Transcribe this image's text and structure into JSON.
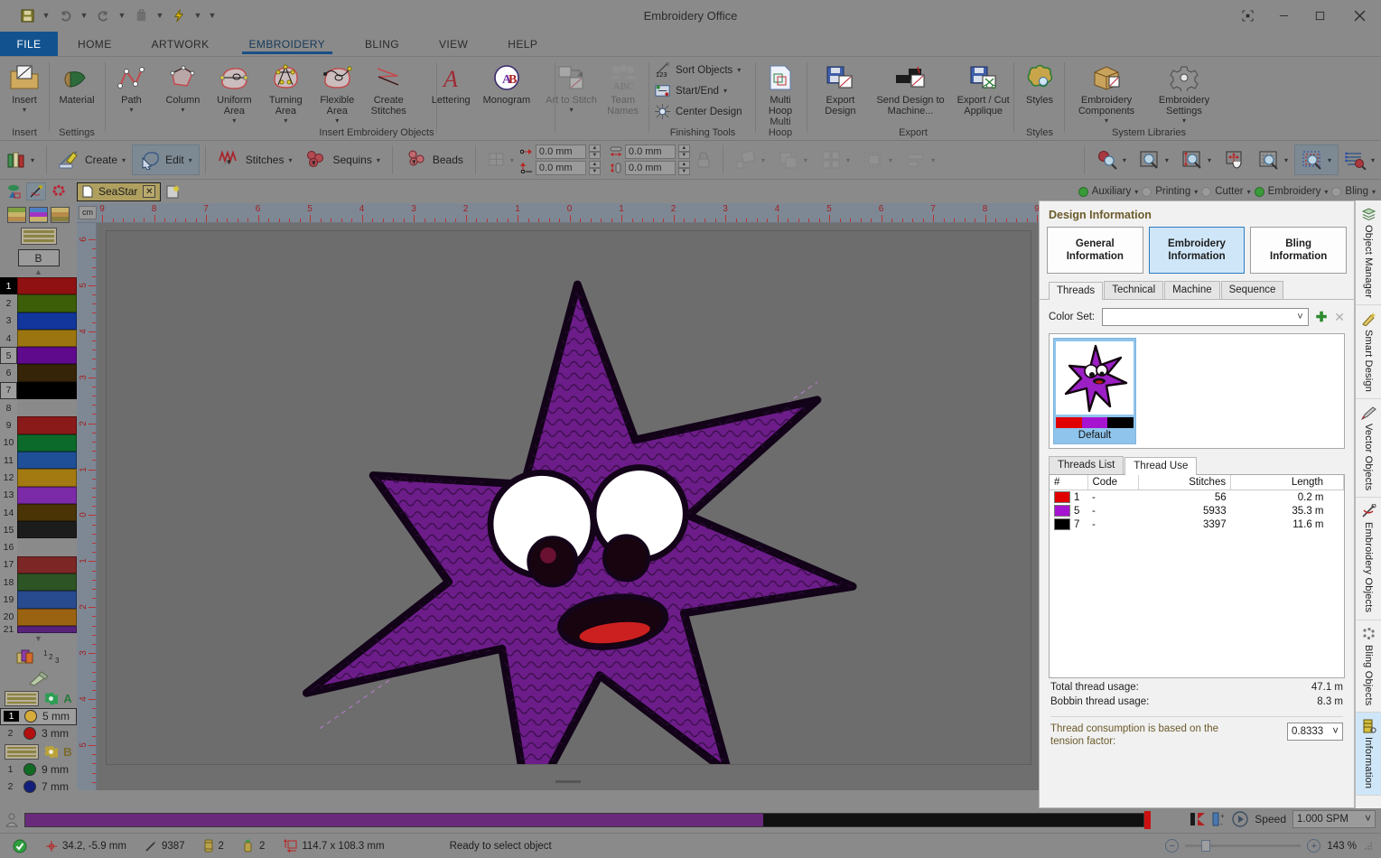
{
  "window": {
    "title": "Embroidery Office",
    "controls": [
      "restore-icon",
      "minimize-icon",
      "maximize-icon",
      "close-icon"
    ]
  },
  "quick_access": {
    "items": [
      {
        "name": "save-icon",
        "enabled": true
      },
      {
        "name": "undo-icon",
        "enabled": false
      },
      {
        "name": "redo-icon",
        "enabled": false
      },
      {
        "name": "clipboard-icon",
        "enabled": false
      },
      {
        "name": "lightning-icon",
        "enabled": true
      }
    ]
  },
  "ribbon": {
    "tabs": [
      {
        "label": "FILE",
        "active": false,
        "file": true
      },
      {
        "label": "HOME",
        "active": false
      },
      {
        "label": "ARTWORK",
        "active": false
      },
      {
        "label": "EMBROIDERY",
        "active": true
      },
      {
        "label": "BLING",
        "active": false
      },
      {
        "label": "VIEW",
        "active": false
      },
      {
        "label": "HELP",
        "active": false
      }
    ],
    "groups": [
      {
        "label": "Insert",
        "items": [
          {
            "label": "Insert",
            "caret": true,
            "disabled": false
          }
        ]
      },
      {
        "label": "Settings",
        "items": [
          {
            "label": "Material",
            "caret": false,
            "disabled": false
          }
        ]
      },
      {
        "label": "Insert Embroidery Objects",
        "items": [
          {
            "label": "Path",
            "caret": true,
            "disabled": false
          },
          {
            "label": "Column",
            "caret": true,
            "disabled": false
          },
          {
            "label": "Uniform Area",
            "caret": true,
            "disabled": false
          },
          {
            "label": "Turning Area",
            "caret": true,
            "disabled": false
          },
          {
            "label": "Flexible Area",
            "caret": true,
            "disabled": false
          },
          {
            "label": "Create Stitches",
            "caret": false,
            "disabled": false
          },
          {
            "label": "Lettering",
            "caret": false,
            "disabled": false
          },
          {
            "label": "Monogram",
            "caret": false,
            "disabled": false
          },
          {
            "label": "Art to Stitch",
            "caret": true,
            "disabled": true
          },
          {
            "label": "Team Names",
            "caret": false,
            "disabled": true
          }
        ]
      },
      {
        "label": "Finishing Tools",
        "items": [
          {
            "label": "Sort Objects",
            "caret": true,
            "disabled": false
          },
          {
            "label": "Start/End",
            "caret": true,
            "disabled": false
          },
          {
            "label": "Center Design",
            "caret": false,
            "disabled": false
          }
        ]
      },
      {
        "label": "Multi Hoop",
        "items": [
          {
            "label": "Multi Hoop",
            "caret": false,
            "disabled": false
          }
        ]
      },
      {
        "label": "Export",
        "items": [
          {
            "label": "Export Design",
            "caret": false,
            "disabled": false
          },
          {
            "label": "Send Design to Machine...",
            "caret": false,
            "disabled": false
          },
          {
            "label": "Export / Cut Applique",
            "caret": false,
            "disabled": false
          }
        ]
      },
      {
        "label": "Styles",
        "items": [
          {
            "label": "Styles",
            "caret": false,
            "disabled": false
          }
        ]
      },
      {
        "label": "System Libraries",
        "items": [
          {
            "label": "Embroidery Components",
            "caret": true,
            "disabled": false
          },
          {
            "label": "Embroidery Settings",
            "caret": true,
            "disabled": false
          }
        ]
      }
    ]
  },
  "toolbar": {
    "library_icon": "library-icon",
    "buttons": [
      {
        "label": "Create",
        "icon": "create-pencil-icon",
        "caret": true,
        "selected": false
      },
      {
        "label": "Edit",
        "icon": "edit-node-icon",
        "caret": true,
        "selected": true
      },
      {
        "label": "Stitches",
        "icon": "stitches-icon",
        "caret": true,
        "selected": false
      },
      {
        "label": "Sequins",
        "icon": "sequins-icon",
        "caret": true,
        "selected": false
      },
      {
        "label": "Beads",
        "icon": "beads-icon",
        "caret": false,
        "selected": false
      }
    ],
    "transform": {
      "x_value": "0.0 mm",
      "y_value": "0.0 mm",
      "width_value": "0.0 mm",
      "height_value": "0.0 mm",
      "lock_icon": "lock-icon"
    },
    "align_tools": [
      "rotate-icon",
      "group-icon",
      "arrange-grid-icon",
      "order-icon",
      "distribute-icon"
    ],
    "zoom_tools": [
      {
        "icon": "zoom-tool-icon",
        "caret": true,
        "selected": false
      },
      {
        "icon": "zoom-box-icon",
        "caret": true,
        "selected": false
      },
      {
        "icon": "zoom-height-icon",
        "caret": true,
        "selected": false
      },
      {
        "icon": "pan-icon",
        "caret": false,
        "selected": false
      },
      {
        "icon": "zoom-grid-icon",
        "caret": true,
        "selected": false
      },
      {
        "icon": "zoom-selection-icon",
        "caret": true,
        "selected": true
      },
      {
        "icon": "zoom-list-icon",
        "caret": true,
        "selected": false
      }
    ]
  },
  "document": {
    "tab_label": "SeaStar",
    "close_label": "✕",
    "left_icons": [
      "artwork-icon",
      "embroidery-icon",
      "bling-icon"
    ],
    "new_tab_icon": "new-document-icon"
  },
  "status_lights": [
    {
      "label": "Auxiliary",
      "on": true
    },
    {
      "label": "Printing",
      "on": false
    },
    {
      "label": "Cutter",
      "on": false
    },
    {
      "label": "Embroidery",
      "on": true
    },
    {
      "label": "Bling",
      "on": false
    }
  ],
  "left_palette": {
    "mode_swatches": [
      {
        "name": "swatch-set-a",
        "colors": [
          "#7fa040",
          "#c9b36a",
          "#b78b4a"
        ]
      },
      {
        "name": "swatch-set-b",
        "colors": [
          "#4d7fc4",
          "#a234c4",
          "#c9b36a"
        ]
      },
      {
        "name": "swatch-set-c",
        "colors": [
          "#c9b36a",
          "#b78b4a",
          "#8a7f3c"
        ]
      }
    ],
    "b_button": "B",
    "colors": [
      {
        "index": "1",
        "hex": "#8f1111",
        "state": "active"
      },
      {
        "index": "2",
        "hex": "#3d5e08",
        "state": "normal"
      },
      {
        "index": "3",
        "hex": "#12369b",
        "state": "normal"
      },
      {
        "index": "4",
        "hex": "#9b7510",
        "state": "normal"
      },
      {
        "index": "5",
        "hex": "#5f0a8c",
        "state": "boxed"
      },
      {
        "index": "6",
        "hex": "#352408",
        "state": "normal"
      },
      {
        "index": "7",
        "hex": "#000000",
        "state": "boxed"
      },
      {
        "index": "8",
        "hex": "",
        "state": "empty"
      },
      {
        "index": "9",
        "hex": "#8a1a1a",
        "state": "normal"
      },
      {
        "index": "10",
        "hex": "#0c6b2a",
        "state": "normal"
      },
      {
        "index": "11",
        "hex": "#1f4f96",
        "state": "normal"
      },
      {
        "index": "12",
        "hex": "#a37a11",
        "state": "normal"
      },
      {
        "index": "13",
        "hex": "#7b2aa8",
        "state": "normal"
      },
      {
        "index": "14",
        "hex": "#4a3405",
        "state": "normal"
      },
      {
        "index": "15",
        "hex": "#1c1c1c",
        "state": "normal"
      },
      {
        "index": "16",
        "hex": "",
        "state": "empty"
      },
      {
        "index": "17",
        "hex": "#7c2626",
        "state": "normal"
      },
      {
        "index": "18",
        "hex": "#2d5424",
        "state": "normal"
      },
      {
        "index": "19",
        "hex": "#284a8e",
        "state": "normal"
      },
      {
        "index": "20",
        "hex": "#9a6312",
        "state": "normal"
      },
      {
        "index": "21",
        "hex": "#56227a",
        "state": "normal"
      }
    ],
    "sequin_header_icon": "sequin-stack-icon",
    "sequin_number_icon": "numbering-icon",
    "dropper_icon": "eyedropper-icon",
    "groups": [
      {
        "letter": "A",
        "gear_icon": "gear-icon",
        "rows": [
          {
            "index": "1",
            "size": "5 mm",
            "hex": "#d8ac3a",
            "selected": true
          },
          {
            "index": "2",
            "size": "3 mm",
            "hex": "#b41010",
            "selected": false
          }
        ]
      },
      {
        "letter": "B",
        "gear_icon": "gear-icon",
        "rows": [
          {
            "index": "1",
            "size": "9 mm",
            "hex": "#0f6b22",
            "selected": false
          },
          {
            "index": "2",
            "size": "7 mm",
            "hex": "#121f7a",
            "selected": false
          }
        ]
      }
    ]
  },
  "rulers": {
    "unit": "cm",
    "h_labels": [
      "9",
      "8",
      "7",
      "6",
      "5",
      "4",
      "3",
      "2",
      "1",
      "0",
      "1",
      "2",
      "3",
      "4",
      "5",
      "6",
      "7",
      "8",
      "9"
    ],
    "v_labels": [
      "6",
      "5",
      "4",
      "3",
      "2",
      "1",
      "0",
      "1",
      "2",
      "3",
      "4",
      "5"
    ]
  },
  "design_info": {
    "title": "Design Information",
    "segments": [
      {
        "line1": "General",
        "line2": "Information",
        "active": false
      },
      {
        "line1": "Embroidery",
        "line2": "Information",
        "active": true
      },
      {
        "line1": "Bling",
        "line2": "Information",
        "active": false
      }
    ],
    "tabs": [
      {
        "label": "Threads",
        "active": true
      },
      {
        "label": "Technical",
        "active": false
      },
      {
        "label": "Machine",
        "active": false
      },
      {
        "label": "Sequence",
        "active": false
      }
    ],
    "color_set_label": "Color Set:",
    "color_set_value": "",
    "add_icon": "plus-icon",
    "remove_icon": "delete-x-icon",
    "thread_set": {
      "name": "Default",
      "stripe_colors": [
        "#e00000",
        "#a714cf",
        "#000000"
      ]
    },
    "list_tabs": [
      {
        "label": "Threads List",
        "active": false
      },
      {
        "label": "Thread Use",
        "active": true
      }
    ],
    "table": {
      "headers": [
        "#",
        "Code",
        "Stitches",
        "Length"
      ],
      "rows": [
        {
          "num": "1",
          "color": "#e00000",
          "code": "-",
          "stitches": "56",
          "length": "0.2 m"
        },
        {
          "num": "5",
          "color": "#a714cf",
          "code": "-",
          "stitches": "5933",
          "length": "35.3 m"
        },
        {
          "num": "7",
          "color": "#000000",
          "code": "-",
          "stitches": "3397",
          "length": "11.6 m"
        }
      ]
    },
    "total_label": "Total thread usage:",
    "total_value": "47.1 m",
    "bobbin_label": "Bobbin thread usage:",
    "bobbin_value": "8.3 m",
    "tension_label": "Thread consumption is based on the tension factor:",
    "tension_value": "0.8333"
  },
  "right_dock": [
    {
      "label": "Object Manager",
      "icon": "layers-icon",
      "active": false
    },
    {
      "label": "Smart Design",
      "icon": "wand-icon",
      "active": false
    },
    {
      "label": "Vector Objects",
      "icon": "pen-icon",
      "active": false
    },
    {
      "label": "Embroidery Objects",
      "icon": "needle-icon",
      "active": false
    },
    {
      "label": "Bling Objects",
      "icon": "bling-dots-icon",
      "active": false
    },
    {
      "label": "Information",
      "icon": "information-icon",
      "active": true
    }
  ],
  "statusbar": {
    "ready_icon": "ok-check-icon",
    "coords_icon": "crosshair-icon",
    "coords": "34.2, -5.9 mm",
    "stitches_icon": "needle-small-icon",
    "stitches": "9387",
    "bobbin_icon": "spool-icon",
    "bobbin_count": "2",
    "jump_icon": "jump-icon",
    "jump_count": "2",
    "size_icon": "size-icon",
    "size": "114.7 x 108.3 mm",
    "message": "Ready to select object",
    "speed_label": "Speed",
    "speed_value": "1.000 SPM",
    "play_icon": "play-icon",
    "stop_icon": "stop-icon",
    "zoom_out_icon": "zoom-out-icon",
    "zoom_in_icon": "zoom-in-icon",
    "zoom_value": "143 %"
  }
}
